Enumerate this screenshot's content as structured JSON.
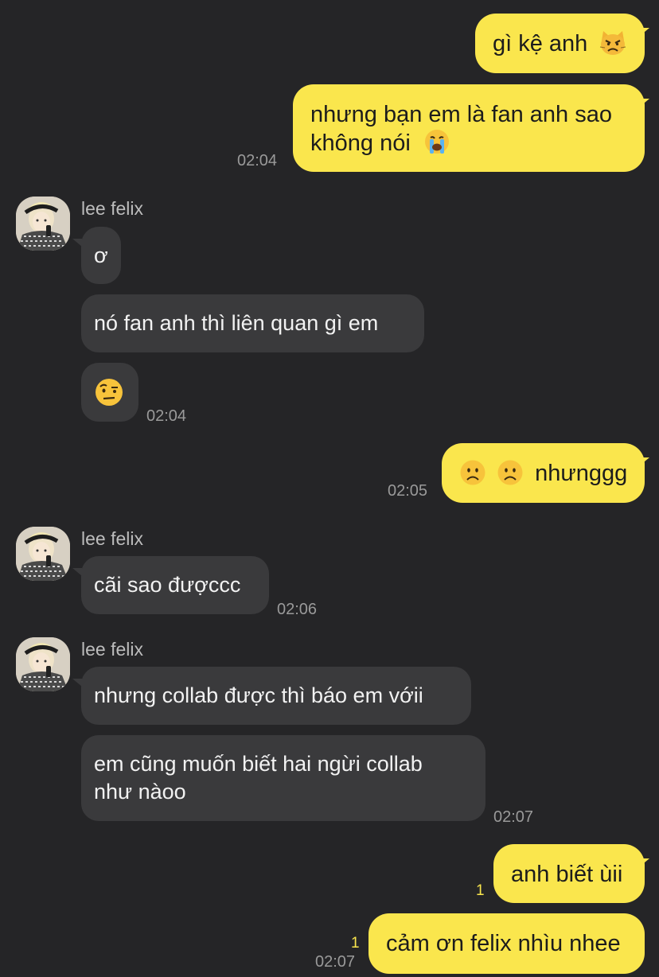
{
  "contact": {
    "name": "lee felix"
  },
  "messages": {
    "m1": "gì kệ anh",
    "m2_line1": "nhưng bạn em là fan anh sao",
    "m2_line2": "không nói",
    "t1": "02:04",
    "f1": "ơ",
    "f2": "nó fan anh thì liên quan gì em",
    "t2": "02:04",
    "m3": "nhưnggg",
    "t3": "02:05",
    "f3": "cãi sao đượccc",
    "t4": "02:06",
    "f4": "nhưng collab được thì báo em vớii",
    "f5_line1": "em cũng muốn biết hai ngừi collab",
    "f5_line2": "như nàoo",
    "t5": "02:07",
    "m4": "anh biết ùii",
    "m4_unread": "1",
    "m5": "cảm ơn felix nhìu nhee",
    "m5_unread": "1",
    "t6": "02:07"
  },
  "icons": {
    "m1_emoji": "pouting-cat-face-icon",
    "m2_emoji": "loudly-crying-face-icon",
    "f_emoji": "face-with-raised-eyebrow-icon",
    "m3_emoji": "frowning-face-icon"
  },
  "colors": {
    "background": "#252527",
    "my_bubble": "#FAE64D",
    "their_bubble": "#3a3a3c",
    "unread": "#FAE64D"
  }
}
